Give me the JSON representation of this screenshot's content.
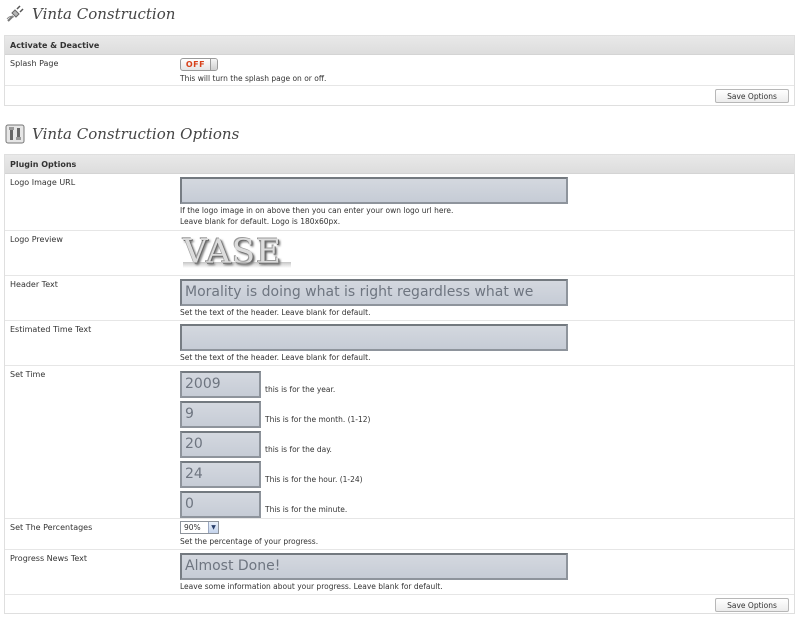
{
  "section1": {
    "title": "Vinta Construction",
    "icon": "plug-icon",
    "box_header": "Activate & Deactive",
    "splash": {
      "label": "Splash Page",
      "toggle_state": "OFF",
      "description": "This will turn the splash page on or off."
    },
    "save_label": "Save Options"
  },
  "section2": {
    "title": "Vinta Construction Options",
    "icon": "tools-icon",
    "box_header": "Plugin Options",
    "logo_url": {
      "label": "Logo Image URL",
      "value": "",
      "desc1": "If the logo image in on above then you can enter your own logo url here.",
      "desc2": "Leave blank for default. Logo is 180x60px."
    },
    "logo_preview": {
      "label": "Logo Preview",
      "logo_text": "VASE"
    },
    "header_text": {
      "label": "Header Text",
      "value": "Morality is doing what is right regardless what we",
      "description": "Set the text of the header. Leave blank for default."
    },
    "estimated_time": {
      "label": "Estimated Time Text",
      "value": "",
      "description": "Set the text of the header. Leave blank for default."
    },
    "set_time": {
      "label": "Set Time",
      "fields": [
        {
          "value": "2009",
          "description": "this is for the year."
        },
        {
          "value": "9",
          "description": "This is for the month. (1-12)"
        },
        {
          "value": "20",
          "description": "this is for the day."
        },
        {
          "value": "24",
          "description": "This is for the hour. (1-24)"
        },
        {
          "value": "0",
          "description": "This is for the minute."
        }
      ]
    },
    "percentages": {
      "label": "Set The Percentages",
      "selected": "90%",
      "description": "Set the percentage of your progress."
    },
    "progress_news": {
      "label": "Progress News Text",
      "value": "Almost Done!",
      "description": "Leave some information about your progress. Leave blank for default."
    },
    "save_label": "Save Options"
  },
  "colors": {
    "toggle_off": "#d8411a",
    "header_bg": "#e3e3e3",
    "input_bg": "#cdd2da"
  }
}
